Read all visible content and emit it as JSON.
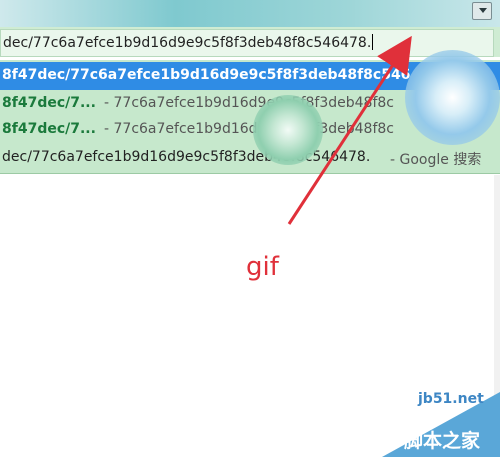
{
  "url_bar": {
    "value": "dec/77c6a7efce1b9d16d9e9c5f8f3deb48f8c546478."
  },
  "dropdown": {
    "items": [
      {
        "bold": "8f47dec/77c6a7efce1b9d16d9e9c5f8f3deb48f8c546",
        "rest": ""
      },
      {
        "bold": "8f47dec/7...",
        "rest": " - 77c6a7efce1b9d16d9e9c5f8f3deb48f8c"
      },
      {
        "bold": "8f47dec/7...",
        "rest": " - 77c6a7efce1b9d16d9e9c5f8f3deb48f8c"
      },
      {
        "bold": "",
        "rest": "dec/77c6a7efce1b9d16d9e9c5f8f3deb48f8c546478.",
        "suffix": " - Google 搜索"
      }
    ]
  },
  "annotation": {
    "label": "gif"
  },
  "watermark": {
    "site": "jb51.net",
    "brand": "脚本之家",
    "color": "#5aa7d8"
  },
  "colors": {
    "selected": "#2f8ce5",
    "arrow": "#e0303a"
  }
}
